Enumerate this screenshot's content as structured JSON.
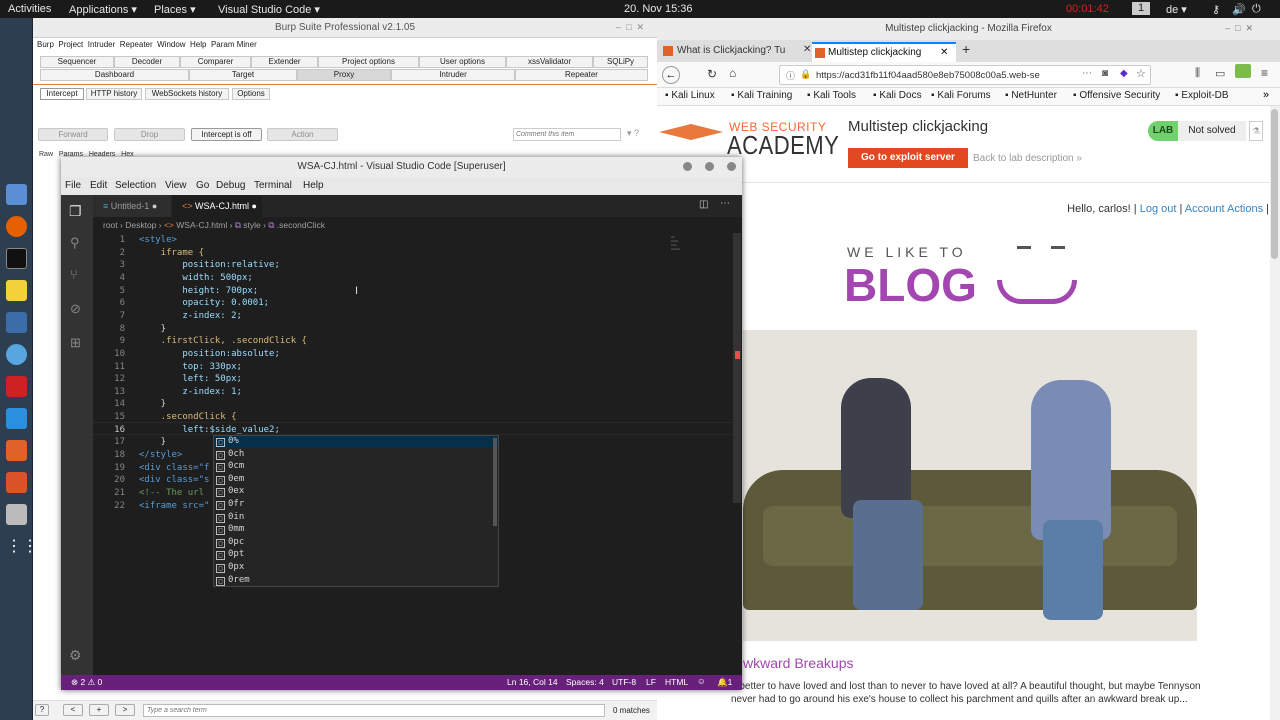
{
  "topbar": {
    "activities": "Activities",
    "applications": "Applications ▾",
    "places": "Places ▾",
    "app": "Visual Studio Code ▾",
    "datetime": "20. Nov  15:36",
    "timer": "00:01:42",
    "workspace": "1",
    "lang": "de ▾"
  },
  "burp": {
    "title": "Burp Suite Professional v2.1.05",
    "menu": [
      "Burp",
      "Project",
      "Intruder",
      "Repeater",
      "Window",
      "Help",
      "Param Miner"
    ],
    "tabs_row1": [
      "Sequencer",
      "Decoder",
      "Comparer",
      "Extender",
      "Project options",
      "User options",
      "xssValidator",
      "SQLiPy"
    ],
    "tabs_row2": [
      "Dashboard",
      "Target",
      "Proxy",
      "Intruder",
      "Repeater"
    ],
    "subtabs": [
      "Intercept",
      "HTTP history",
      "WebSockets history",
      "Options"
    ],
    "buttons": [
      "Forward",
      "Drop",
      "Intercept is off",
      "Action"
    ],
    "comment_placeholder": "Comment this item",
    "rawtabs": [
      "Raw",
      "Params",
      "Headers",
      "Hex"
    ],
    "search_placeholder": "Type a search term",
    "matches": "0 matches"
  },
  "firefox": {
    "title": "Multistep clickjacking - Mozilla Firefox",
    "tabs": [
      "What is Clickjacking? Tu",
      "Multistep clickjacking"
    ],
    "url": "https://acd31fb11f04aad580e8eb75008c00a5.web-se",
    "bookmarks": [
      "Kali Linux",
      "Kali Training",
      "Kali Tools",
      "Kali Docs",
      "Kali Forums",
      "NetHunter",
      "Offensive Security",
      "Exploit-DB"
    ],
    "logo_top": "WEB SECURITY",
    "logo_bottom": "ACADEMY",
    "lab_title": "Multistep clickjacking",
    "lab_badge": "LAB",
    "lab_status": "Not solved",
    "exploit_btn": "Go to exploit server",
    "back_link": "Back to lab description »",
    "account": {
      "hello": "Hello, carlos! |",
      "logout": "Log out",
      "sep": "|",
      "actions": "Account Actions",
      "end": "|"
    },
    "blog_small": "WE LIKE TO",
    "blog_big": "BLOG",
    "post_title": "wkward Breakups",
    "post_text": "It better to have loved and lost than to never to have loved at all? A beautiful thought, but maybe Tennyson never had to go around his exe's house to collect his parchment and quills after an awkward break up..."
  },
  "vscode": {
    "title": "WSA-CJ.html - Visual Studio Code [Superuser]",
    "menu": [
      "File",
      "Edit",
      "Selection",
      "View",
      "Go",
      "Debug",
      "Terminal",
      "Help"
    ],
    "tabs": [
      "Untitled-1",
      "WSA-CJ.html"
    ],
    "breadcrumb": [
      "root",
      "Desktop",
      "WSA-CJ.html",
      "style",
      ".secondClick"
    ],
    "lines": [
      "<style>",
      "    iframe {",
      "        position:relative;",
      "        width: 500px;",
      "        height: 700px;",
      "        opacity: 0.0001;",
      "        z-index: 2;",
      "    }",
      "    .firstClick, .secondClick {",
      "        position:absolute;",
      "        top: 330px;",
      "        left: 50px;",
      "        z-index: 1;",
      "    }",
      "    .secondClick {",
      "        left:$side_value2;",
      "    }",
      "</style>",
      "<div class=\"f",
      "<div class=\"s",
      "<!-- The url",
      "<iframe src=\""
    ],
    "autocomplete": [
      "0%",
      "0ch",
      "0cm",
      "0em",
      "0ex",
      "0fr",
      "0in",
      "0mm",
      "0pc",
      "0pt",
      "0px",
      "0rem"
    ],
    "status": {
      "problems": "⊗ 2 ⚠ 0",
      "position": "Ln 16, Col 14",
      "spaces": "Spaces: 4",
      "encoding": "UTF-8",
      "eol": "LF",
      "lang": "HTML",
      "bell": "🔔1"
    }
  }
}
